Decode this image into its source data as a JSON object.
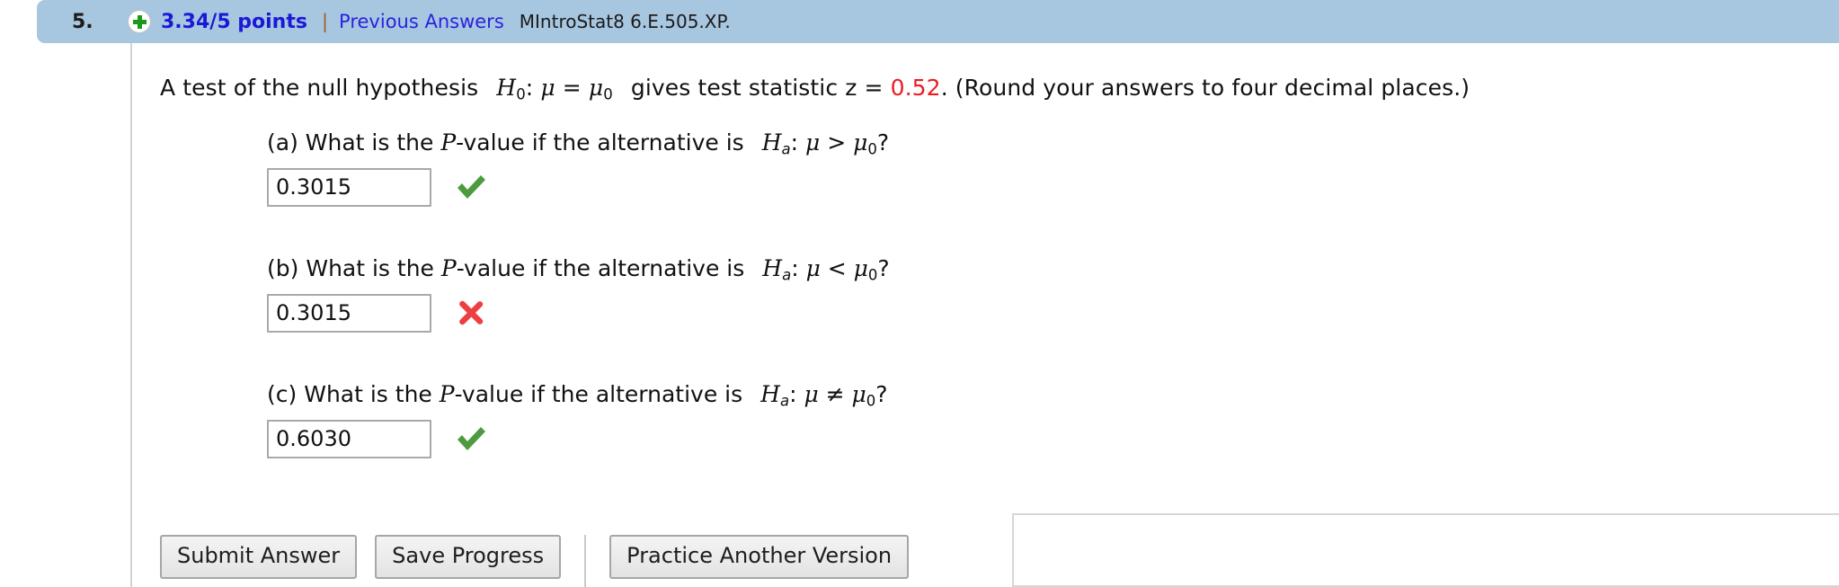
{
  "header": {
    "question_number": "5.",
    "status_icon": "plus-circle-icon",
    "points": "3.34/5 points",
    "separator": "|",
    "previous_answers_link": "Previous Answers",
    "problem_id": "MIntroStat8 6.E.505.XP."
  },
  "prompt": {
    "lead": "A test of the null hypothesis",
    "null_hypothesis": "H0: μ = μ0",
    "middle": "gives test statistic z =",
    "z_value": "0.52",
    "period": ".",
    "rounding_note": "(Round your answers to four decimal places.)"
  },
  "parts": [
    {
      "label": "(a)",
      "question_lead": "What is the",
      "pvalue_term": "P-value if the alternative is",
      "alternative": "Ha: μ > μ0?",
      "answer_value": "0.3015",
      "result_icon": "green-check-icon",
      "result_status": "correct"
    },
    {
      "label": "(b)",
      "question_lead": "What is the",
      "pvalue_term": "P-value if the alternative is",
      "alternative": "Ha: μ < μ0?",
      "answer_value": "0.3015",
      "result_icon": "red-x-icon",
      "result_status": "incorrect"
    },
    {
      "label": "(c)",
      "question_lead": "What is the",
      "pvalue_term": "P-value if the alternative is",
      "alternative": "Ha: μ ≠ μ0?",
      "answer_value": "0.6030",
      "result_icon": "green-check-icon",
      "result_status": "correct"
    }
  ],
  "footer": {
    "submit_label": "Submit Answer",
    "save_label": "Save Progress",
    "practice_label": "Practice Another Version"
  },
  "colors": {
    "header_bg": "#a7c6e0",
    "points_text": "#1c19d6",
    "link_text": "#2b22de",
    "z_value": "#ec1c24",
    "check_green": "#4e9a3f",
    "x_red": "#ef3e42"
  }
}
